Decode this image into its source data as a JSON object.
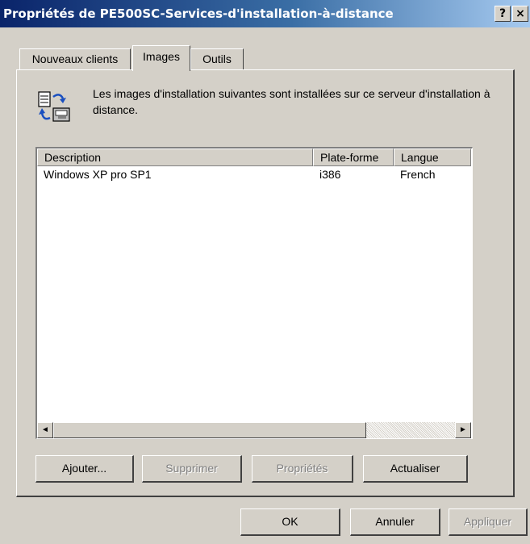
{
  "window": {
    "title": "Propriétés de PE500SC-Services-d'installation-à-distance",
    "help_label": "?",
    "close_label": "×"
  },
  "tabs": [
    {
      "label": "Nouveaux clients"
    },
    {
      "label": "Images"
    },
    {
      "label": "Outils"
    }
  ],
  "info": {
    "icon": "install-images-icon",
    "text": "Les images d'installation suivantes sont installées sur ce serveur d'installation à distance."
  },
  "list": {
    "columns": [
      "Description",
      "Plate-forme",
      "Langue"
    ],
    "rows": [
      [
        "Windows XP pro SP1",
        "i386",
        "French"
      ]
    ]
  },
  "scrollbar": {
    "left_arrow": "◄",
    "right_arrow": "►"
  },
  "panel_buttons": {
    "add": "Ajouter...",
    "remove": "Supprimer",
    "properties": "Propriétés",
    "refresh": "Actualiser"
  },
  "dialog_buttons": {
    "ok": "OK",
    "cancel": "Annuler",
    "apply": "Appliquer"
  }
}
